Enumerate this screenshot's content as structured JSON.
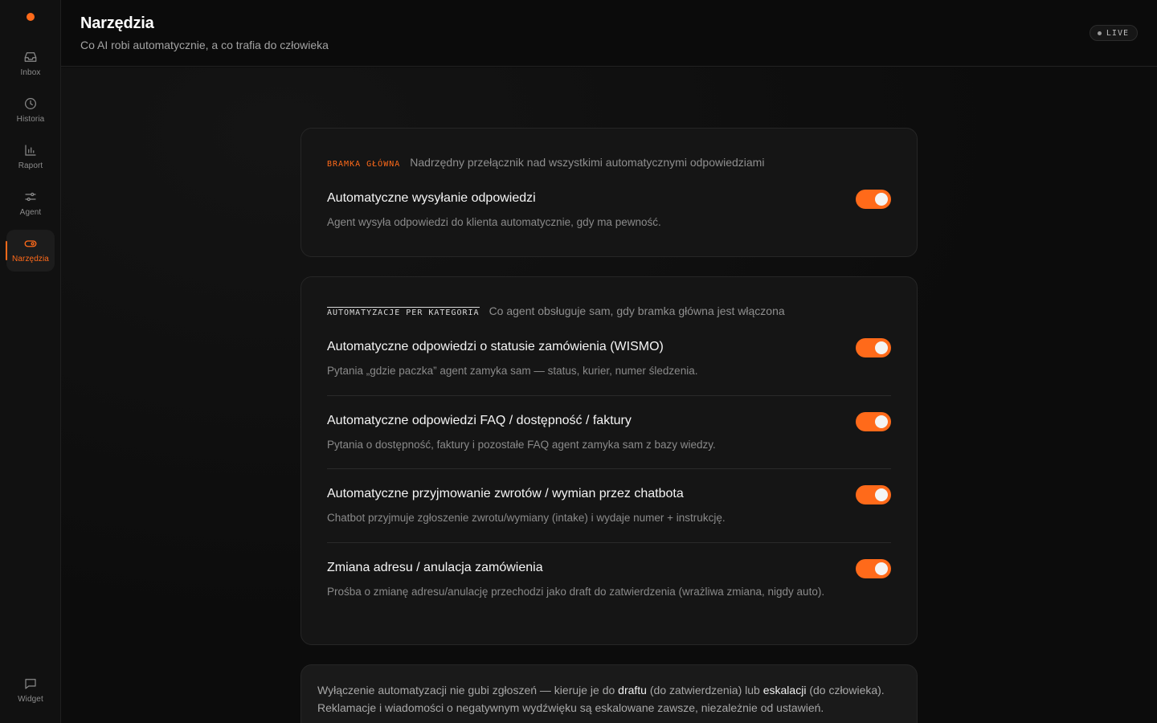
{
  "sidebar": {
    "items": [
      {
        "label": "Inbox",
        "icon": "inbox-icon"
      },
      {
        "label": "Historia",
        "icon": "clock-icon"
      },
      {
        "label": "Raport",
        "icon": "bar-chart-icon"
      },
      {
        "label": "Agent",
        "icon": "sliders-icon"
      },
      {
        "label": "Narzędzia",
        "icon": "toggle-icon",
        "active": true
      }
    ],
    "bottom_item": {
      "label": "Widget",
      "icon": "chat-bubble-icon"
    }
  },
  "header": {
    "title": "Narzędzia",
    "subtitle": "Co AI robi automatycznie, a co trafia do człowieka",
    "badge": "LIVE"
  },
  "gate": {
    "tag": "BRAMKA GŁÓWNA",
    "description": "Nadrzędny przełącznik nad wszystkimi automatycznymi odpowiedziami",
    "title": "Automatyczne wysyłanie odpowiedzi",
    "desc": "Agent wysyła odpowiedzi do klienta automatycznie, gdy ma pewność.",
    "enabled": true
  },
  "categories": {
    "tag": "AUTOMATYZACJE PER KATEGORIA",
    "description": "Co agent obsługuje sam, gdy bramka główna jest włączona",
    "items": [
      {
        "title": "Automatyczne odpowiedzi o statusie zamówienia (WISMO)",
        "desc": "Pytania „gdzie paczka” agent zamyka sam — status, kurier, numer śledzenia.",
        "enabled": true
      },
      {
        "title": "Automatyczne odpowiedzi FAQ / dostępność / faktury",
        "desc": "Pytania o dostępność, faktury i pozostałe FAQ agent zamyka sam z bazy wiedzy.",
        "enabled": true
      },
      {
        "title": "Automatyczne przyjmowanie zwrotów / wymian przez chatbota",
        "desc": "Chatbot przyjmuje zgłoszenie zwrotu/wymiany (intake) i wydaje numer + instrukcję.",
        "enabled": true
      },
      {
        "title": "Zmiana adresu / anulacja zamówienia",
        "desc": "Prośba o zmianę adresu/anulację przechodzi jako draft do zatwierdzenia (wrażliwa zmiana, nigdy auto).",
        "enabled": true
      }
    ]
  },
  "info": {
    "part1": "Wyłączenie automatyzacji nie gubi zgłoszeń — kieruje je do ",
    "draft": "draftu",
    "part2": " (do zatwierdzenia) lub ",
    "escalation": "eskalacji",
    "part3": " (do człowieka).",
    "line2": "Reklamacje i wiadomości o negatywnym wydźwięku są eskalowane zawsze, niezależnie od ustawień."
  },
  "colors": {
    "accent": "#ff6a1a",
    "background": "#0c0c0c",
    "card": "#151515"
  }
}
